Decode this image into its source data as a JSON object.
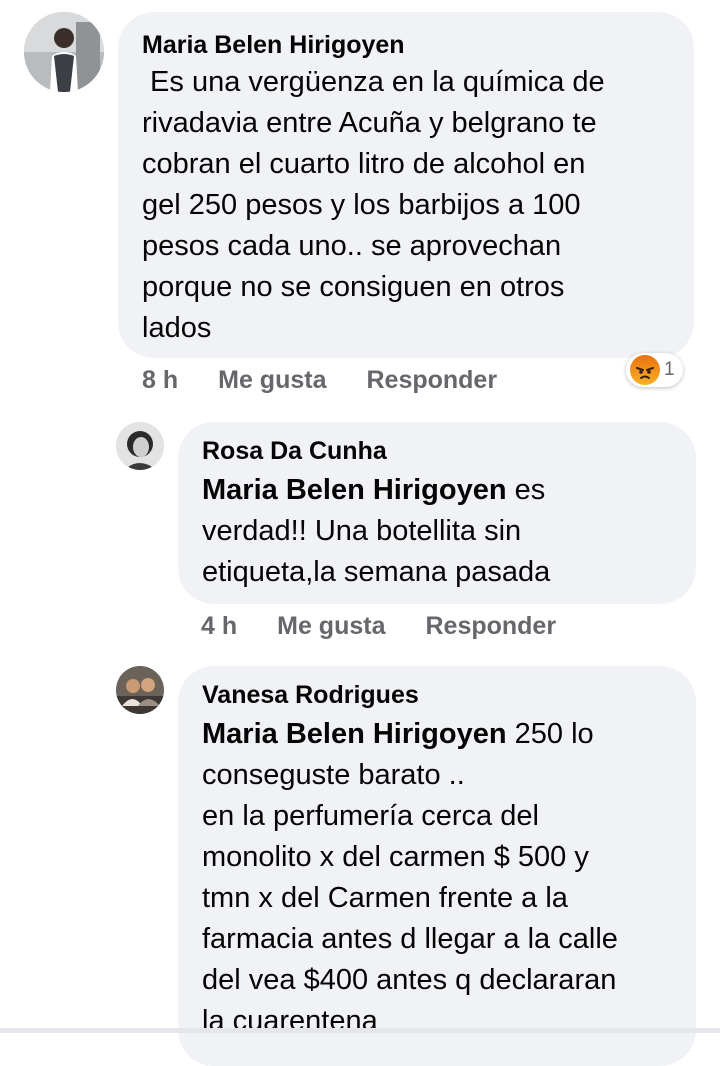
{
  "comments": [
    {
      "author": "Maria Belen Hirigoyen",
      "lines": [
        " Es una vergüenza en la química de",
        "rivadavia entre Acuña y belgrano te",
        "cobran el cuarto litro de alcohol en",
        "gel 250 pesos y los barbijos a 100",
        "pesos cada uno.. se aprovechan",
        "porque no se consiguen en otros",
        "lados"
      ],
      "time": "8 h",
      "like": "Me gusta",
      "reply": "Responder",
      "reaction_icon": "angry-reaction-icon",
      "reaction_count": "1"
    }
  ],
  "replies": [
    {
      "author": "Rosa Da Cunha",
      "mention": "Maria Belen Hirigoyen",
      "first_line_rest": " es",
      "lines": [
        "verdad!! Una botellita sin",
        "etiqueta,la semana pasada"
      ],
      "time": "4 h",
      "like": "Me gusta",
      "reply": "Responder"
    },
    {
      "author": "Vanesa Rodrigues",
      "mention": "Maria Belen Hirigoyen",
      "first_line_rest": " 250 lo",
      "lines": [
        "conseguste barato ..",
        "en la perfumería cerca del",
        "monolito x del carmen $ 500 y",
        "tmn x del Carmen frente a la",
        "farmacia antes d llegar a la calle",
        "del vea $400 antes q declararan",
        "la cuarentena"
      ]
    }
  ],
  "colors": {
    "bubble": "#f0f2f5",
    "meta_text": "#65676b",
    "body_text": "#050505"
  }
}
